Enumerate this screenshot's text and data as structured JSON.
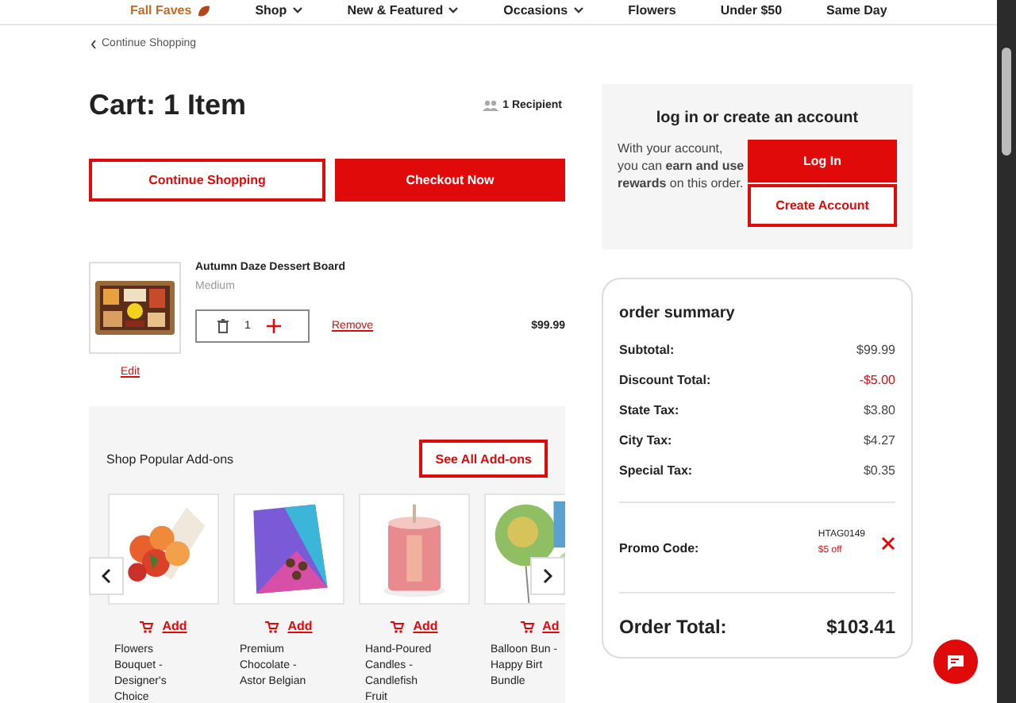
{
  "nav": [
    {
      "label": "Fall Faves",
      "kind": "featured"
    },
    {
      "label": "Shop",
      "kind": "dropdown"
    },
    {
      "label": "New & Featured",
      "kind": "dropdown"
    },
    {
      "label": "Occasions",
      "kind": "dropdown"
    },
    {
      "label": "Flowers",
      "kind": "plain"
    },
    {
      "label": "Under $50",
      "kind": "plain"
    },
    {
      "label": "Same Day",
      "kind": "plain"
    }
  ],
  "back_link": "Continue Shopping",
  "cart": {
    "title": "Cart: 1 Item",
    "recipients": "1 Recipient",
    "continue_button": "Continue Shopping",
    "checkout_button": "Checkout Now",
    "items": [
      {
        "name": "Autumn Daze Dessert Board",
        "size": "Medium",
        "quantity": "1",
        "remove": "Remove",
        "price": "$99.99",
        "edit": "Edit"
      }
    ]
  },
  "addons": {
    "title": "Shop Popular Add-ons",
    "see_all": "See All Add-ons",
    "products": [
      {
        "kind": "bouquet",
        "add": "Add",
        "name": "Flowers Bouquet - Designer's Choice"
      },
      {
        "kind": "chocolate",
        "add": "Add",
        "name": "Premium Chocolate - Astor Belgian"
      },
      {
        "kind": "candle",
        "add": "Add",
        "name": "Hand-Poured Candles - Candlefish Fruit"
      },
      {
        "kind": "balloon",
        "add": "Ad",
        "name": "Balloon Bun - Happy Birt Bundle"
      }
    ]
  },
  "account": {
    "title": "log in or create an account",
    "text": "With your account, you can **earn and use rewards** on this order.",
    "login_button": "Log In",
    "create_button": "Create Account"
  },
  "summary": {
    "title": "order summary",
    "rows": [
      {
        "label": "Subtotal:",
        "value": "$99.99",
        "discount": false
      },
      {
        "label": "Discount Total:",
        "value": "-$5.00",
        "discount": true
      },
      {
        "label": "State Tax:",
        "value": "$3.80",
        "discount": false
      },
      {
        "label": "City Tax:",
        "value": "$4.27",
        "discount": false
      },
      {
        "label": "Special Tax:",
        "value": "$0.35",
        "discount": false
      }
    ],
    "promo": {
      "label": "Promo Code:",
      "code": "HTAG0149",
      "note": "$5 off"
    },
    "total_label": "Order Total:",
    "total": "$103.41"
  }
}
